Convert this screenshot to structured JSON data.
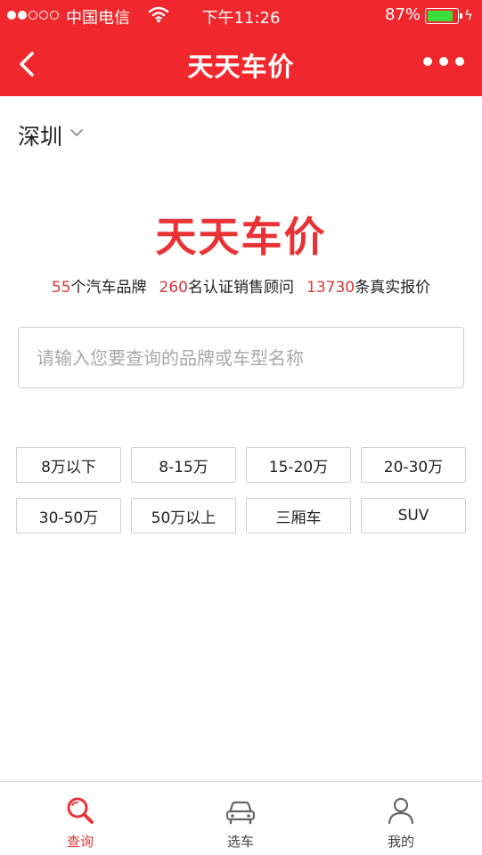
{
  "status_bar": {
    "carrier": "中国电信",
    "time": "下午11:26",
    "battery_percent": "87%",
    "battery_level": 0.87,
    "signal_bars_filled": 2,
    "signal_bars_total": 5
  },
  "nav": {
    "title": "天天车价",
    "back_icon": "chevron-left-icon",
    "more_icon": "more-dots-icon"
  },
  "city": {
    "name": "深圳",
    "icon": "chevron-down-icon"
  },
  "brand": {
    "logo_text": "天天车价",
    "color": "#e83236"
  },
  "stats": {
    "brands_count": "55",
    "brands_label": "个汽车品牌",
    "advisors_count": "260",
    "advisors_label": "名认证销售顾问",
    "quotes_count": "13730",
    "quotes_label": "条真实报价"
  },
  "search": {
    "value": "",
    "placeholder": "请输入您要查询的品牌或车型名称"
  },
  "filters": [
    "8万以下",
    "8-15万",
    "15-20万",
    "20-30万",
    "30-50万",
    "50万以上",
    "三厢车",
    "SUV"
  ],
  "tabs": [
    {
      "label": "查询",
      "icon": "search-icon",
      "active": true
    },
    {
      "label": "选车",
      "icon": "car-icon",
      "active": false
    },
    {
      "label": "我的",
      "icon": "user-icon",
      "active": false
    }
  ],
  "colors": {
    "accent": "#f0282d",
    "active_tab": "#e83236"
  }
}
